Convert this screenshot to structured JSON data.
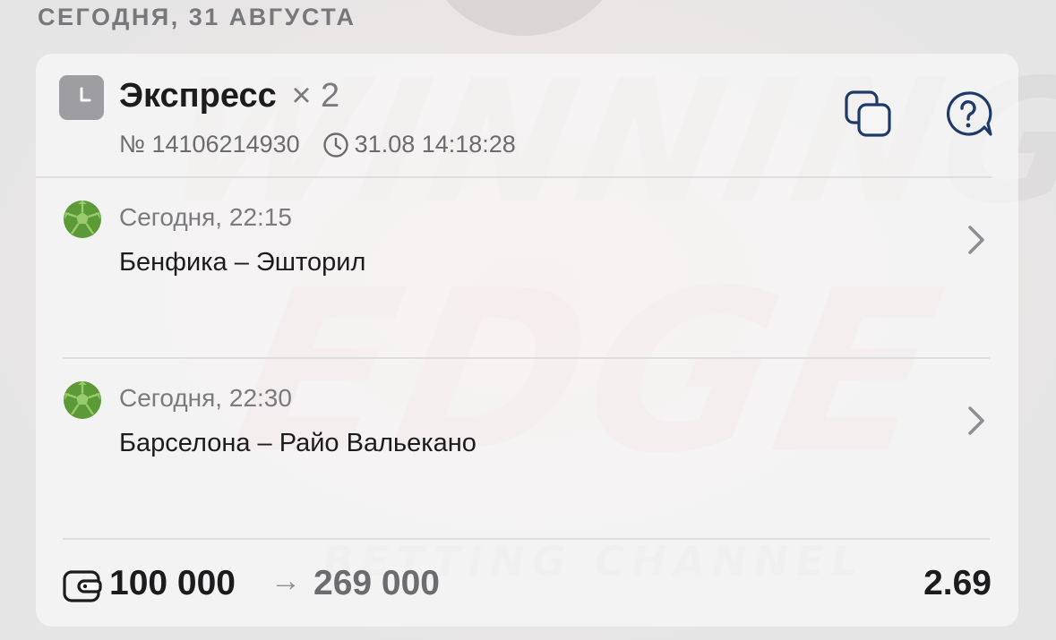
{
  "date_header": "СЕГОДНЯ, 31 АВГУСТА",
  "watermark": {
    "line1": "WINNING",
    "line2": "EDGE",
    "line3": "BETTING CHANNEL"
  },
  "bet": {
    "type_label": "Экспресс",
    "count_label": "× 2",
    "number": "№ 14106214930",
    "datetime": "31.08 14:18:28",
    "icons": {
      "type": "clock-icon",
      "copy": "copy-icon",
      "help": "question-icon"
    }
  },
  "events": [
    {
      "time": "Сегодня, 22:15",
      "match": "Бенфика – Эшторил",
      "sport_icon": "football-icon"
    },
    {
      "time": "Сегодня, 22:30",
      "match": "Барселона – Райо Вальекано",
      "sport_icon": "football-icon"
    }
  ],
  "footer": {
    "stake": "100 000",
    "arrow": "→",
    "payout": "269 000",
    "odds": "2.69"
  },
  "colors": {
    "accent_blue": "#1f3a68",
    "ball_green": "#5b9a37",
    "text_primary": "#1c1c1e",
    "text_secondary": "#7b7b7f"
  }
}
